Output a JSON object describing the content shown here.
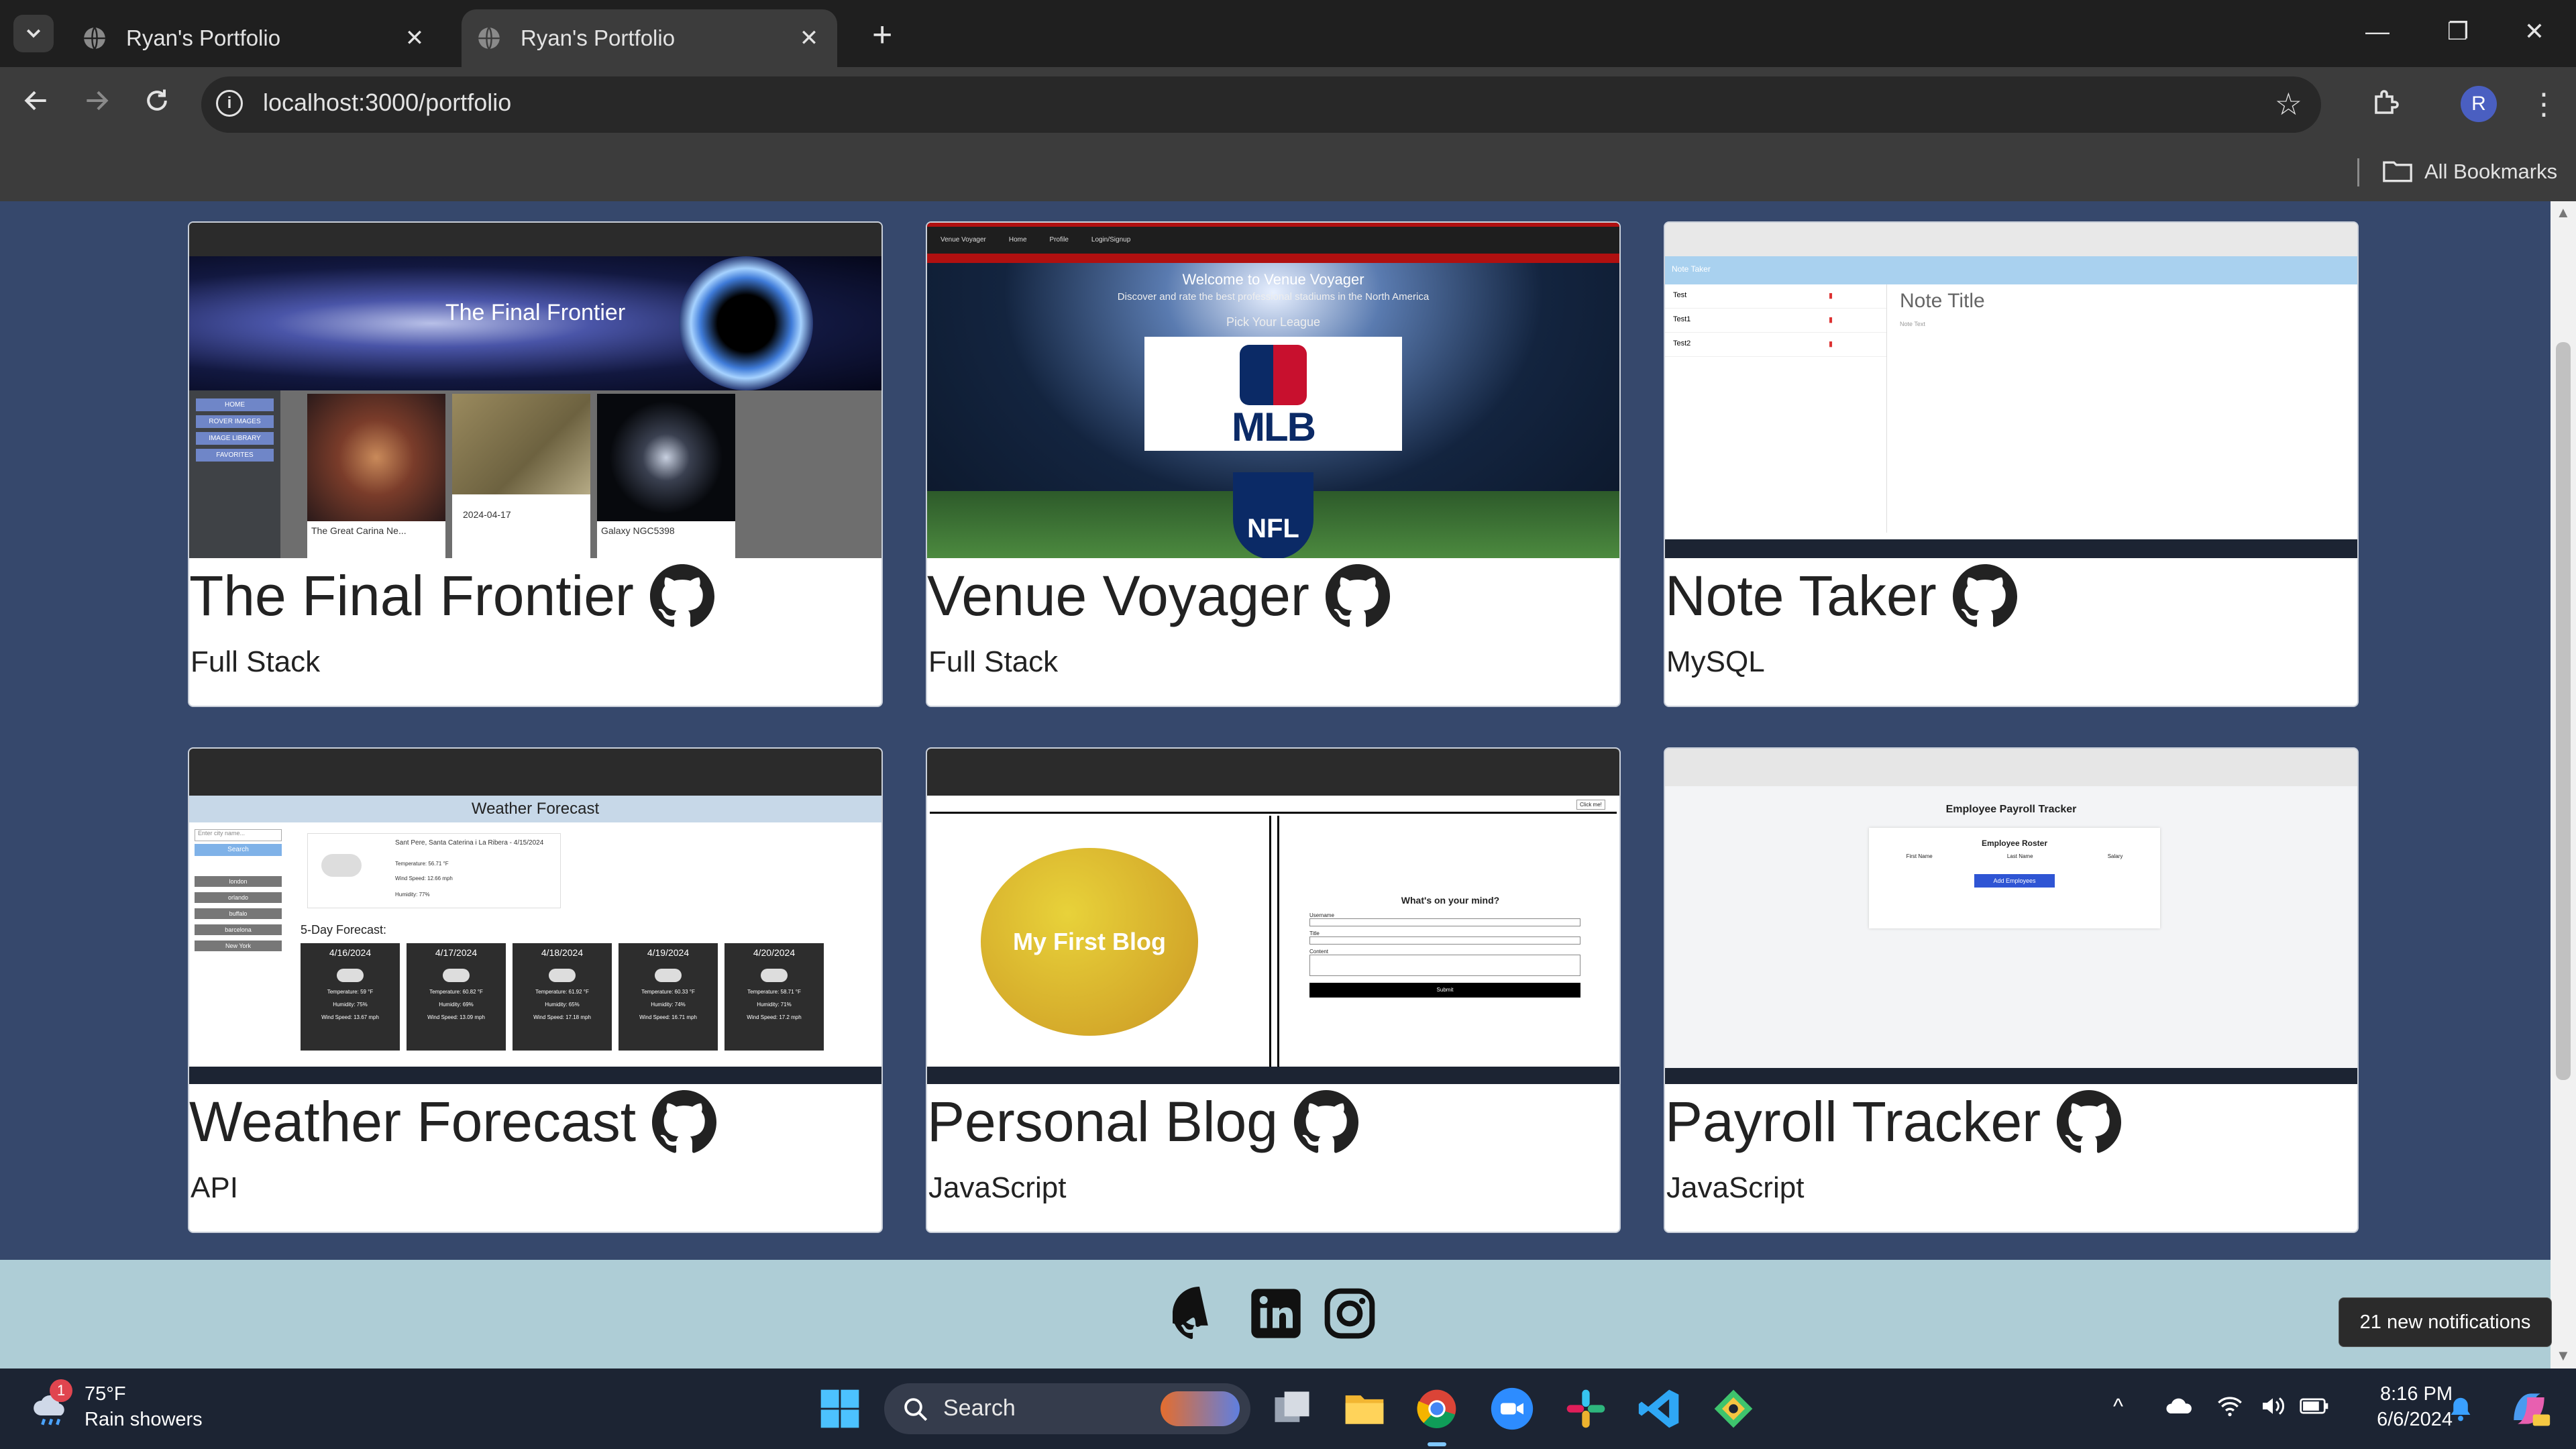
{
  "browser": {
    "tabs": [
      {
        "title": "Ryan's Portfolio",
        "active": false
      },
      {
        "title": "Ryan's Portfolio",
        "active": true
      }
    ],
    "url": "localhost:3000/portfolio",
    "profile_initial": "R",
    "bookmarks_label": "All Bookmarks"
  },
  "projects": [
    {
      "title": "The Final Frontier",
      "tag": "Full Stack",
      "thumb": "final-frontier",
      "thumb_text": {
        "hero": "The Final Frontier",
        "nav": [
          "HOME",
          "ROVER IMAGES",
          "IMAGE LIBRARY",
          "FAVORITES"
        ],
        "captions": [
          "The Great Carina Ne...",
          "2024-04-17",
          "Galaxy NGC5398"
        ]
      }
    },
    {
      "title": "Venue Voyager",
      "tag": "Full Stack",
      "thumb": "venue-voyager",
      "thumb_text": {
        "nav": [
          "Venue Voyager",
          "Home",
          "Profile",
          "Login/Signup"
        ],
        "headline": "Welcome to Venue Voyager",
        "sub": "Discover and rate the best professional stadiums in the North America",
        "pick": "Pick Your League",
        "league1": "MLB",
        "league2": "NFL"
      }
    },
    {
      "title": "Note Taker",
      "tag": "MySQL",
      "thumb": "note-taker",
      "thumb_text": {
        "header": "Note Taker",
        "notes": [
          "Test",
          "Test1",
          "Test2"
        ],
        "note_title": "Note Title",
        "note_text": "Note Text"
      }
    },
    {
      "title": "Weather Forecast",
      "tag": "API",
      "thumb": "weather",
      "thumb_text": {
        "header": "Weather Forecast",
        "search_placeholder": "Enter city name...",
        "search_btn": "Search",
        "cities": [
          "london",
          "orlando",
          "buffalo",
          "barcelona",
          "New York"
        ],
        "current_city": "Sant Pere, Santa Caterina i La Ribera - 4/15/2024",
        "current_temp": "Temperature: 56.71 °F",
        "current_wind": "Wind Speed: 12.66 mph",
        "current_hum": "Humidity: 77%",
        "forecast_label": "5-Day Forecast:",
        "days": [
          {
            "date": "4/16/2024",
            "temp": "Temperature: 59 °F",
            "hum": "Humidity: 75%",
            "wind": "Wind Speed: 13.67 mph"
          },
          {
            "date": "4/17/2024",
            "temp": "Temperature: 60.82 °F",
            "hum": "Humidity: 69%",
            "wind": "Wind Speed: 13.09 mph"
          },
          {
            "date": "4/18/2024",
            "temp": "Temperature: 61.92 °F",
            "hum": "Humidity: 65%",
            "wind": "Wind Speed: 17.18 mph"
          },
          {
            "date": "4/19/2024",
            "temp": "Temperature: 60.33 °F",
            "hum": "Humidity: 74%",
            "wind": "Wind Speed: 16.71 mph"
          },
          {
            "date": "4/20/2024",
            "temp": "Temperature: 58.71 °F",
            "hum": "Humidity: 71%",
            "wind": "Wind Speed: 17.2 mph"
          }
        ]
      }
    },
    {
      "title": "Personal Blog",
      "tag": "JavaScript",
      "thumb": "blog",
      "thumb_text": {
        "blog_name": "My First Blog",
        "form_title": "What's on your mind?",
        "fields": [
          "Username",
          "Title",
          "Content"
        ],
        "submit": "Submit",
        "click": "Click me!"
      }
    },
    {
      "title": "Payroll Tracker",
      "tag": "JavaScript",
      "thumb": "payroll",
      "thumb_text": {
        "header": "Employee Payroll Tracker",
        "roster": "Employee Roster",
        "cols": [
          "First Name",
          "Last Name",
          "Salary"
        ],
        "add_btn": "Add Employees"
      }
    }
  ],
  "footer": {
    "icons": [
      "github-icon",
      "linkedin-icon",
      "instagram-icon"
    ]
  },
  "notification_toast": "21 new notifications",
  "taskbar": {
    "weather_temp": "75°F",
    "weather_desc": "Rain showers",
    "weather_badge": "1",
    "search_label": "Search",
    "time": "8:16 PM",
    "date": "6/6/2024"
  },
  "colors": {
    "page_bg": "#36486c",
    "footer_bg": "#aecdd6",
    "taskbar_bg": "#1c2433"
  }
}
